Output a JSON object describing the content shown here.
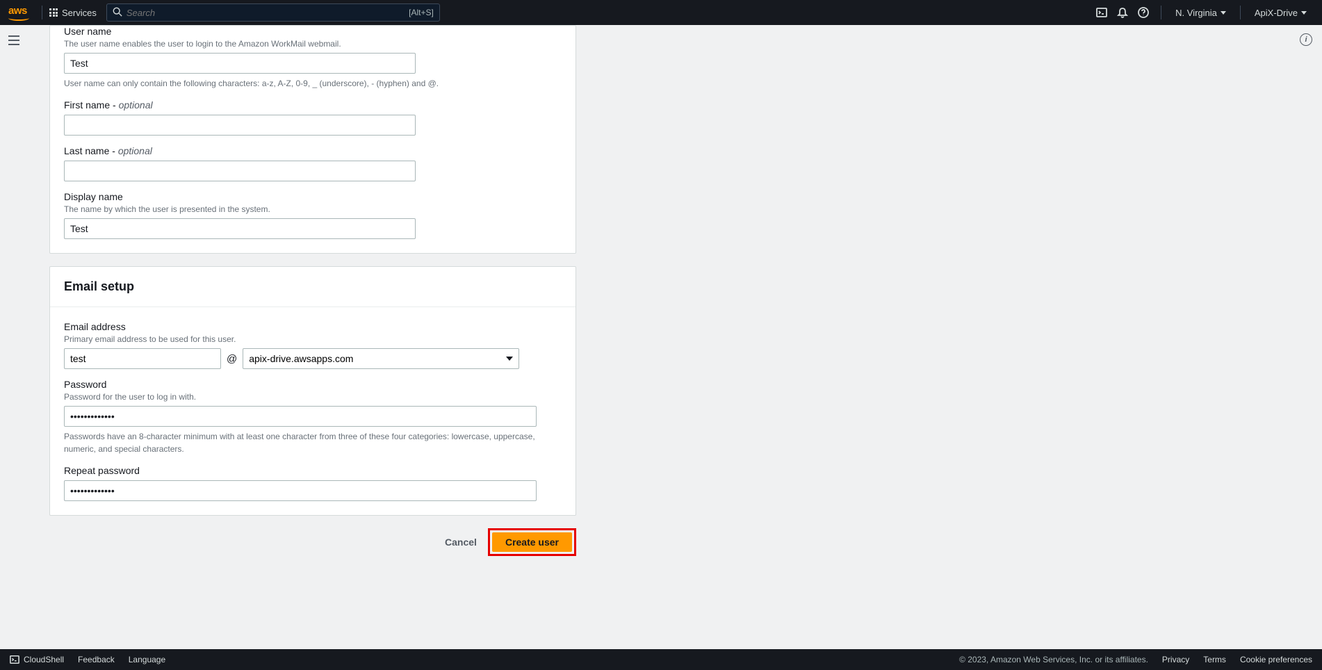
{
  "nav": {
    "services": "Services",
    "search_placeholder": "Search",
    "search_shortcut": "[Alt+S]",
    "region": "N. Virginia",
    "account": "ApiX-Drive"
  },
  "form": {
    "username": {
      "label": "User name",
      "sublabel": "The user name enables the user to login to the Amazon WorkMail webmail.",
      "value": "Test",
      "hint": "User name can only contain the following characters: a-z, A-Z, 0-9, _ (underscore), - (hyphen) and @."
    },
    "firstname": {
      "label": "First name - ",
      "optional": "optional",
      "value": ""
    },
    "lastname": {
      "label": "Last name - ",
      "optional": "optional",
      "value": ""
    },
    "displayname": {
      "label": "Display name",
      "sublabel": "The name by which the user is presented in the system.",
      "value": "Test"
    },
    "email_section_title": "Email setup",
    "email": {
      "label": "Email address",
      "sublabel": "Primary email address to be used for this user.",
      "local_value": "test",
      "at": "@",
      "domain": "apix-drive.awsapps.com"
    },
    "password": {
      "label": "Password",
      "sublabel": "Password for the user to log in with.",
      "value": "•••••••••••••",
      "hint": "Passwords have an 8-character minimum with at least one character from three of these four categories: lowercase, uppercase, numeric, and special characters."
    },
    "repeat_password": {
      "label": "Repeat password",
      "value": "•••••••••••••"
    }
  },
  "actions": {
    "cancel": "Cancel",
    "create": "Create user"
  },
  "footer": {
    "cloudshell": "CloudShell",
    "feedback": "Feedback",
    "language": "Language",
    "copyright": "© 2023, Amazon Web Services, Inc. or its affiliates.",
    "privacy": "Privacy",
    "terms": "Terms",
    "cookies": "Cookie preferences"
  }
}
